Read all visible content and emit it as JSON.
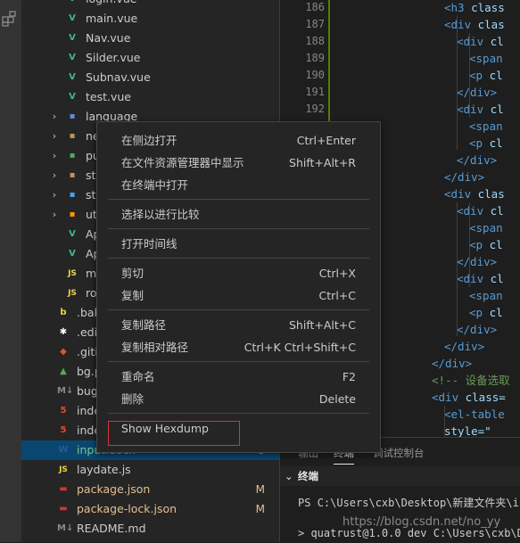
{
  "explorer": {
    "rows": [
      {
        "name": "login.vue",
        "icon": "vue-file-icon",
        "glyph": "V",
        "color": "#41b883",
        "chevron": "",
        "badge": ""
      },
      {
        "name": "main.vue",
        "icon": "vue-file-icon",
        "glyph": "V",
        "color": "#41b883",
        "chevron": "",
        "badge": ""
      },
      {
        "name": "Nav.vue",
        "icon": "vue-file-icon",
        "glyph": "V",
        "color": "#41b883",
        "chevron": "",
        "badge": ""
      },
      {
        "name": "Silder.vue",
        "icon": "vue-file-icon",
        "glyph": "V",
        "color": "#41b883",
        "chevron": "",
        "badge": ""
      },
      {
        "name": "Subnav.vue",
        "icon": "vue-file-icon",
        "glyph": "V",
        "color": "#41b883",
        "chevron": "",
        "badge": ""
      },
      {
        "name": "test.vue",
        "icon": "vue-file-icon",
        "glyph": "V",
        "color": "#41b883",
        "chevron": "",
        "badge": ""
      },
      {
        "name": "language",
        "icon": "folder-icon",
        "glyph": "▪",
        "color": "#5b8fd6",
        "chevron": "›",
        "badge": ""
      },
      {
        "name": "ne",
        "icon": "folder-icon",
        "glyph": "▪",
        "color": "#c09553",
        "chevron": "›",
        "badge": ""
      },
      {
        "name": "pu",
        "icon": "folder-icon",
        "glyph": "▪",
        "color": "#4caf50",
        "chevron": "›",
        "badge": ""
      },
      {
        "name": "sto",
        "icon": "folder-icon",
        "glyph": "▪",
        "color": "#c09553",
        "chevron": "›",
        "badge": ""
      },
      {
        "name": "sty",
        "icon": "folder-icon",
        "glyph": "▪",
        "color": "#42a5f5",
        "chevron": "›",
        "badge": ""
      },
      {
        "name": "uti",
        "icon": "folder-icon",
        "glyph": "▪",
        "color": "#ff9800",
        "chevron": "›",
        "badge": ""
      },
      {
        "name": "Ap",
        "icon": "vue-file-icon",
        "glyph": "V",
        "color": "#41b883",
        "chevron": "",
        "badge": ""
      },
      {
        "name": "Ap",
        "icon": "vue-file-icon",
        "glyph": "V",
        "color": "#41b883",
        "chevron": "",
        "badge": ""
      },
      {
        "name": "ma",
        "icon": "js-file-icon",
        "glyph": "JS",
        "color": "#e8d44d",
        "chevron": "",
        "badge": ""
      },
      {
        "name": "rou",
        "icon": "js-file-icon",
        "glyph": "JS",
        "color": "#e8d44d",
        "chevron": "",
        "badge": ""
      },
      {
        "name": ".bab",
        "icon": "babel-file-icon",
        "glyph": "b",
        "color": "#e8d44d",
        "chevron": "",
        "badge": ""
      },
      {
        "name": ".edit",
        "icon": "editorconfig-file-icon",
        "glyph": "✱",
        "color": "#ffffff",
        "chevron": "",
        "badge": ""
      },
      {
        "name": ".gitig",
        "icon": "git-file-icon",
        "glyph": "◆",
        "color": "#e94e31",
        "chevron": "",
        "badge": ""
      },
      {
        "name": "bg.p",
        "icon": "image-file-icon",
        "glyph": "▲",
        "color": "#4caf50",
        "chevron": "",
        "badge": ""
      },
      {
        "name": "bug",
        "icon": "markdown-file-icon",
        "glyph": "M↓",
        "color": "#888888",
        "chevron": "",
        "badge": ""
      },
      {
        "name": "inde",
        "icon": "html-file-icon",
        "glyph": "5",
        "color": "#e44d26",
        "chevron": "",
        "badge": ""
      },
      {
        "name": "inde",
        "icon": "html-file-icon",
        "glyph": "5",
        "color": "#e44d26",
        "chevron": "",
        "badge": ""
      },
      {
        "name": "input.docx",
        "icon": "word-file-icon",
        "glyph": "W",
        "color": "#2b579a",
        "chevron": "",
        "badge": "U"
      },
      {
        "name": "laydate.js",
        "icon": "js-file-icon",
        "glyph": "JS",
        "color": "#e8d44d",
        "chevron": "",
        "badge": ""
      },
      {
        "name": "package.json",
        "icon": "npm-file-icon",
        "glyph": "▬",
        "color": "#cb3837",
        "chevron": "",
        "badge": "M"
      },
      {
        "name": "package-lock.json",
        "icon": "npm-file-icon",
        "glyph": "▬",
        "color": "#cb3837",
        "chevron": "",
        "badge": "M"
      },
      {
        "name": "README.md",
        "icon": "markdown-file-icon",
        "glyph": "M↓",
        "color": "#888888",
        "chevron": "",
        "badge": ""
      }
    ]
  },
  "editor": {
    "lines": [
      {
        "n": "186",
        "indent": 0,
        "tag": "<h3",
        "rest": " class",
        "attr": true
      },
      {
        "n": "187",
        "indent": 0,
        "tag": "<div",
        "rest": " clas",
        "attr": true
      },
      {
        "n": "188",
        "indent": 1,
        "tag": "<div",
        "rest": " cl",
        "attr": true
      },
      {
        "n": "189",
        "indent": 2,
        "tag": "<span",
        "rest": "",
        "attr": false
      },
      {
        "n": "190",
        "indent": 2,
        "tag": "<p",
        "rest": " cl",
        "attr": true
      },
      {
        "n": "191",
        "indent": 1,
        "tag": "</div>",
        "rest": "",
        "attr": false
      },
      {
        "n": "192",
        "indent": 1,
        "tag": "<div",
        "rest": " cl",
        "attr": true
      },
      {
        "n": "",
        "indent": 2,
        "tag": "<span",
        "rest": "",
        "attr": false
      },
      {
        "n": "",
        "indent": 2,
        "tag": "<p",
        "rest": " cl",
        "attr": true
      },
      {
        "n": "",
        "indent": 1,
        "tag": "</div>",
        "rest": "",
        "attr": false
      },
      {
        "n": "",
        "indent": 0,
        "tag": "</div>",
        "rest": "",
        "attr": false
      },
      {
        "n": "",
        "indent": 0,
        "tag": "<div",
        "rest": " clas",
        "attr": true
      },
      {
        "n": "",
        "indent": 1,
        "tag": "<div",
        "rest": " cl",
        "attr": true
      },
      {
        "n": "",
        "indent": 2,
        "tag": "<span",
        "rest": "",
        "attr": false
      },
      {
        "n": "",
        "indent": 2,
        "tag": "<p",
        "rest": " cl",
        "attr": true
      },
      {
        "n": "",
        "indent": 1,
        "tag": "</div>",
        "rest": "",
        "attr": false
      },
      {
        "n": "",
        "indent": 1,
        "tag": "<div",
        "rest": " cl",
        "attr": true
      },
      {
        "n": "",
        "indent": 2,
        "tag": "<span",
        "rest": "",
        "attr": false
      },
      {
        "n": "",
        "indent": 2,
        "tag": "<p",
        "rest": " cl",
        "attr": true
      },
      {
        "n": "",
        "indent": 1,
        "tag": "</div>",
        "rest": "",
        "attr": false
      },
      {
        "n": "",
        "indent": 0,
        "tag": "</div>",
        "rest": "",
        "attr": false
      },
      {
        "n": "",
        "indent": -1,
        "tag": "</div>",
        "rest": "",
        "attr": false
      },
      {
        "n": "",
        "indent": -1,
        "tag": "<!-- 设备选取",
        "rest": "",
        "attr": false,
        "comment": true
      },
      {
        "n": "",
        "indent": -1,
        "tag": "<div",
        "rest": " class=",
        "attr": true
      },
      {
        "n": "",
        "indent": 0,
        "tag": "<el-table",
        "rest": "",
        "attr": false
      },
      {
        "n": "",
        "indent": 0,
        "tag": "",
        "rest": "  style=\"",
        "attr": true
      }
    ]
  },
  "panel": {
    "tabs": [
      "输出",
      "终端",
      "调试控制台"
    ],
    "terminal_label": "终端",
    "prompt_line": "PS C:\\Users\\cxb\\Desktop\\新建文件夹\\i",
    "next_line": "> quatrust@1.0.0 dev C:\\Users\\cxb\\De"
  },
  "watermark": "https://blog.csdn.net/no_yy",
  "context_menu": {
    "groups": [
      [
        {
          "label": "在侧边打开",
          "key": "Ctrl+Enter"
        },
        {
          "label": "在文件资源管理器中显示",
          "key": "Shift+Alt+R"
        },
        {
          "label": "在终端中打开",
          "key": ""
        }
      ],
      [
        {
          "label": "选择以进行比较",
          "key": ""
        }
      ],
      [
        {
          "label": "打开时间线",
          "key": ""
        }
      ],
      [
        {
          "label": "剪切",
          "key": "Ctrl+X"
        },
        {
          "label": "复制",
          "key": "Ctrl+C"
        }
      ],
      [
        {
          "label": "复制路径",
          "key": "Shift+Alt+C"
        },
        {
          "label": "复制相对路径",
          "key": "Ctrl+K Ctrl+Shift+C"
        }
      ],
      [
        {
          "label": "重命名",
          "key": "F2"
        },
        {
          "label": "删除",
          "key": "Delete"
        }
      ],
      [
        {
          "label": "Show Hexdump",
          "key": ""
        }
      ]
    ],
    "highlight_color": "#e03030"
  }
}
